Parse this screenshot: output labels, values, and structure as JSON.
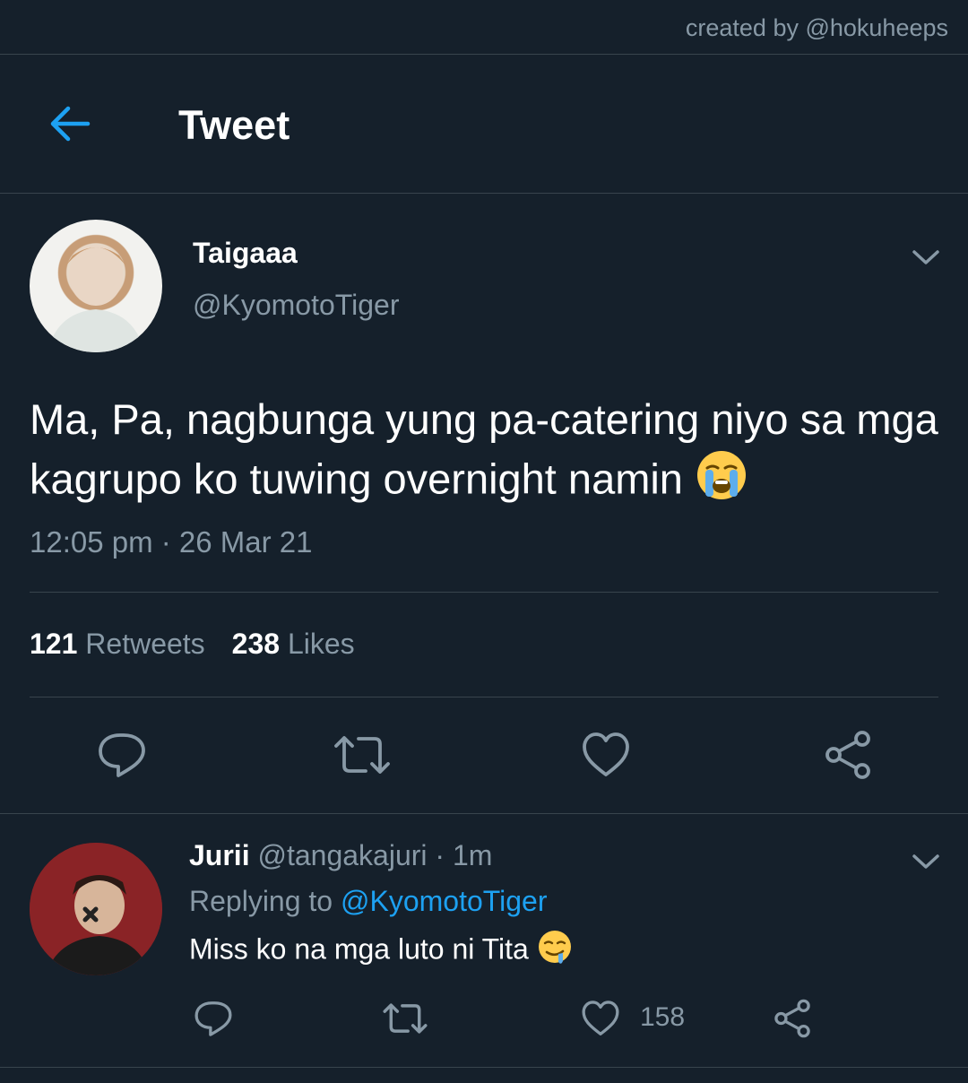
{
  "credit": "created by @hokuheeps",
  "header": {
    "title": "Tweet",
    "back_icon": "arrow-left-icon"
  },
  "tweet": {
    "display_name": "Taigaaa",
    "handle": "@KyomotoTiger",
    "text": "Ma, Pa, nagbunga yung pa-catering niyo sa mga kagrupo ko tuwing overnight namin",
    "emoji": "loudly-crying-face",
    "timestamp": "12:05 pm · 26 Mar 21",
    "retweets_count": "121",
    "retweets_label": "Retweets",
    "likes_count": "238",
    "likes_label": "Likes"
  },
  "reply": {
    "display_name": "Jurii",
    "handle": "@tangakajuri",
    "separator": "·",
    "time": "1m",
    "replying_label": "Replying to",
    "replying_to": "@KyomotoTiger",
    "text": "Miss ko na mga luto ni Tita",
    "emoji": "drooling-face",
    "like_count": "158"
  },
  "colors": {
    "background": "#15202b",
    "accent": "#1da1f2",
    "muted": "#8899a6",
    "divider": "#38444d"
  }
}
